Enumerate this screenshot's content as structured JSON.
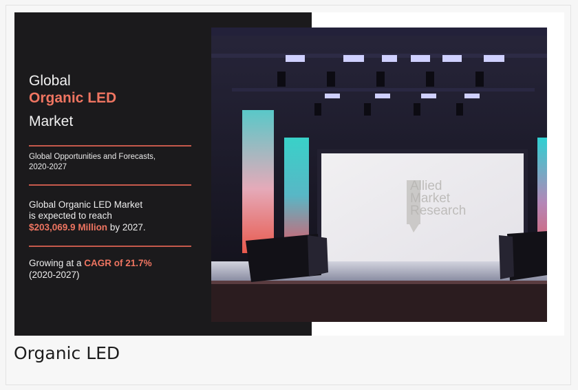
{
  "banner": {
    "title_line1": "Global",
    "title_line2": "Organic LED",
    "title_line3": "Market",
    "subtitle_line1": "Global Opportunities and Forecasts,",
    "subtitle_line2": "2020-2027",
    "stat_line1": "Global Organic LED Market",
    "stat_line2": "is expected to reach",
    "stat_value": "$203,069.9 Million",
    "stat_suffix": " by 2027.",
    "cagr_prefix": "Growing at a ",
    "cagr_value": "CAGR of 21.7%",
    "cagr_period": "(2020-2027)",
    "watermark": [
      "Allied",
      "Market",
      "Research"
    ]
  },
  "caption": "Organic LED",
  "colors": {
    "accent": "#ef7561",
    "panel": "#1b1a1c",
    "rule": "#c85a4c"
  }
}
